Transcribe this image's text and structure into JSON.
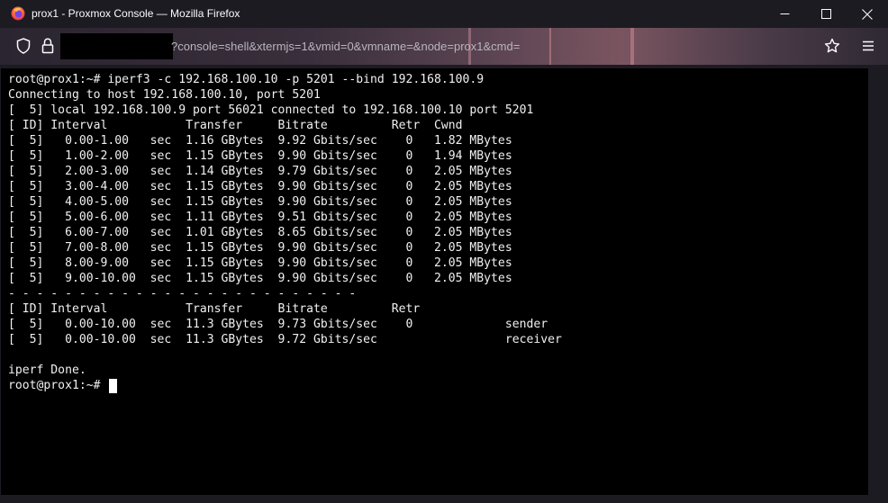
{
  "window": {
    "title": "prox1 - Proxmox Console — Mozilla Firefox",
    "controls": [
      "minimize",
      "maximize",
      "close"
    ]
  },
  "toolbar": {
    "url_visible": "?console=shell&xtermjs=1&vmid=0&vmname=&node=prox1&cmd=",
    "icons": [
      "shield-icon",
      "lock-icon",
      "star-icon",
      "menu-icon"
    ]
  },
  "terminal": {
    "lines": [
      "root@prox1:~# iperf3 -c 192.168.100.10 -p 5201 --bind 192.168.100.9",
      "Connecting to host 192.168.100.10, port 5201",
      "[  5] local 192.168.100.9 port 56021 connected to 192.168.100.10 port 5201",
      "[ ID] Interval           Transfer     Bitrate         Retr  Cwnd",
      "[  5]   0.00-1.00   sec  1.16 GBytes  9.92 Gbits/sec    0   1.82 MBytes",
      "[  5]   1.00-2.00   sec  1.15 GBytes  9.90 Gbits/sec    0   1.94 MBytes",
      "[  5]   2.00-3.00   sec  1.14 GBytes  9.79 Gbits/sec    0   2.05 MBytes",
      "[  5]   3.00-4.00   sec  1.15 GBytes  9.90 Gbits/sec    0   2.05 MBytes",
      "[  5]   4.00-5.00   sec  1.15 GBytes  9.90 Gbits/sec    0   2.05 MBytes",
      "[  5]   5.00-6.00   sec  1.11 GBytes  9.51 Gbits/sec    0   2.05 MBytes",
      "[  5]   6.00-7.00   sec  1.01 GBytes  8.65 Gbits/sec    0   2.05 MBytes",
      "[  5]   7.00-8.00   sec  1.15 GBytes  9.90 Gbits/sec    0   2.05 MBytes",
      "[  5]   8.00-9.00   sec  1.15 GBytes  9.90 Gbits/sec    0   2.05 MBytes",
      "[  5]   9.00-10.00  sec  1.15 GBytes  9.90 Gbits/sec    0   2.05 MBytes",
      "- - - - - - - - - - - - - - - - - - - - - - - - -",
      "[ ID] Interval           Transfer     Bitrate         Retr",
      "[  5]   0.00-10.00  sec  11.3 GBytes  9.73 Gbits/sec    0             sender",
      "[  5]   0.00-10.00  sec  11.3 GBytes  9.72 Gbits/sec                  receiver",
      "",
      "iperf Done.",
      "root@prox1:~# "
    ],
    "colors": {
      "background": "#000000",
      "foreground": "#f0f0f0",
      "cursor": "#ffffff"
    }
  }
}
